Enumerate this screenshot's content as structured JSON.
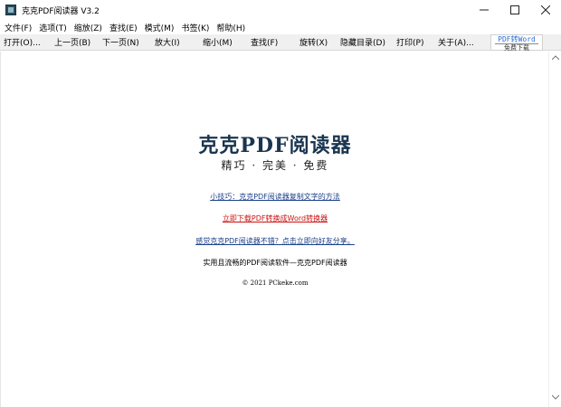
{
  "window": {
    "title": "克克PDF阅读器 V3.2"
  },
  "menu": [
    "文件(F)",
    "选项(T)",
    "缩放(Z)",
    "查找(E)",
    "模式(M)",
    "书签(K)",
    "帮助(H)"
  ],
  "toolbar": {
    "buttons": [
      "打开(O)...",
      "上一页(B)",
      "下一页(N)",
      "放大(I)",
      "缩小(M)",
      "查找(F)",
      "旋转(X)",
      "隐藏目录(D)",
      "打印(P)",
      "关于(A)..."
    ],
    "promo_top": "PDF转Word",
    "promo_bottom": "免费下载"
  },
  "content": {
    "logo_title": "克克PDF阅读器",
    "logo_subtitle": "精巧 · 完美 · 免费",
    "tip_link": "小技巧：克克PDF阅读器复制文字的方法",
    "download_link": "立即下载PDF转换成Word转换器",
    "share_link": "感觉克克PDF阅读器不错？点击立即向好友分享。",
    "tagline": "实用且流畅的PDF阅读软件—克克PDF阅读器",
    "copyright": "© 2021 PCkeke.com"
  },
  "colors": {
    "link_blue": "#1a3f8a",
    "link_red": "#cc1111",
    "logo": "#1a3550",
    "promo": "#2a6fd0"
  }
}
